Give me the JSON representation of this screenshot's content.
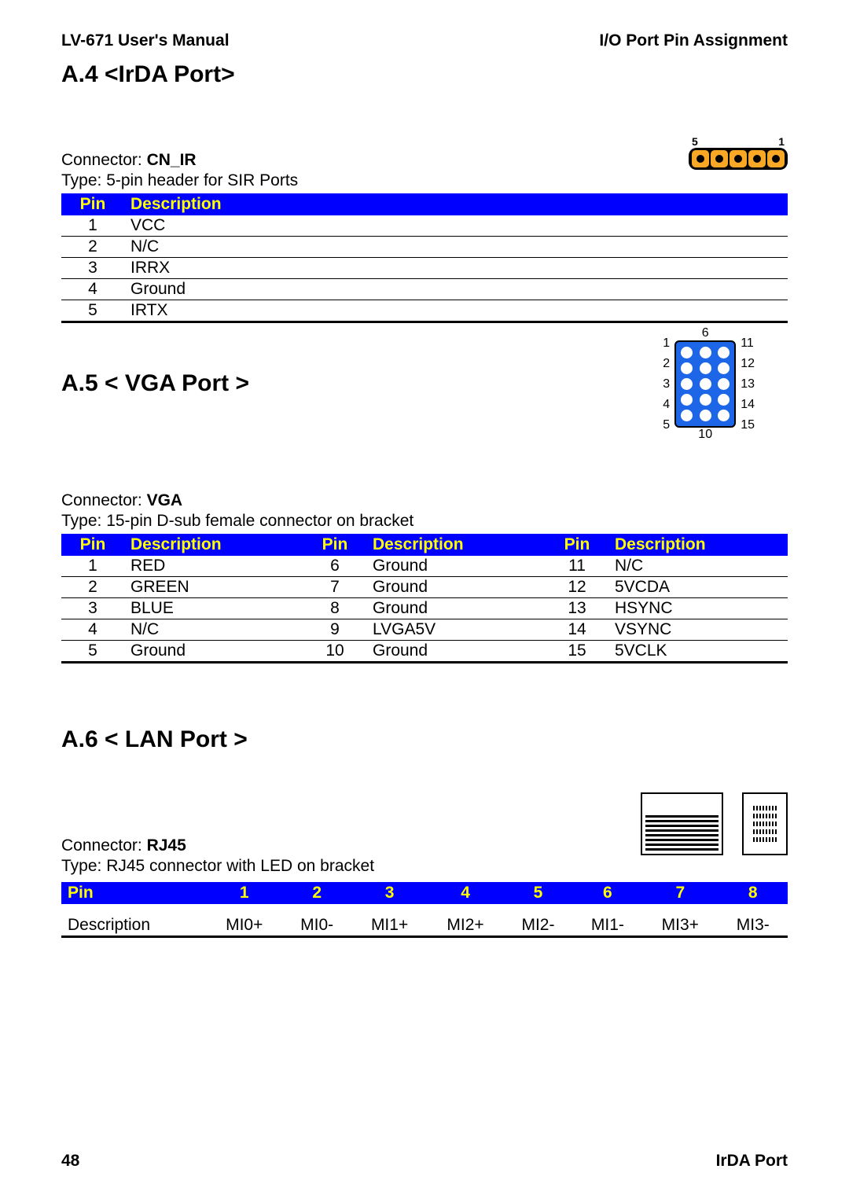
{
  "header": {
    "left": "LV-671 User's Manual",
    "right": "I/O Port Pin Assignment"
  },
  "footer": {
    "page": "48",
    "label": "IrDA Port"
  },
  "irda": {
    "title": "A.4 <IrDA Port>",
    "connector_label": "Connector: ",
    "connector_value": "CN_IR",
    "type": "Type: 5-pin header for SIR Ports",
    "header_labels": {
      "left": "5",
      "right": "1"
    },
    "table_headers": [
      "Pin",
      "Description"
    ],
    "rows": [
      {
        "pin": "1",
        "desc": "VCC"
      },
      {
        "pin": "2",
        "desc": "N/C"
      },
      {
        "pin": "3",
        "desc": "IRRX"
      },
      {
        "pin": "4",
        "desc": "Ground"
      },
      {
        "pin": "5",
        "desc": "IRTX"
      }
    ]
  },
  "vga": {
    "title": "A.5 < VGA Port >",
    "connector_label": "Connector: ",
    "connector_value": "VGA",
    "type": "Type: 15-pin D-sub female connector on bracket",
    "diagram": {
      "left": [
        "1",
        "2",
        "3",
        "4",
        "5"
      ],
      "right": [
        "11",
        "12",
        "13",
        "14",
        "15"
      ],
      "top": "6",
      "bottom": "10"
    },
    "table_headers": [
      "Pin",
      "Description",
      "Pin",
      "Description",
      "Pin",
      "Description"
    ],
    "rows": [
      {
        "p1": "1",
        "d1": "RED",
        "p2": "6",
        "d2": "Ground",
        "p3": "11",
        "d3": "N/C"
      },
      {
        "p1": "2",
        "d1": "GREEN",
        "p2": "7",
        "d2": "Ground",
        "p3": "12",
        "d3": "5VCDA"
      },
      {
        "p1": "3",
        "d1": "BLUE",
        "p2": "8",
        "d2": "Ground",
        "p3": "13",
        "d3": "HSYNC"
      },
      {
        "p1": "4",
        "d1": "N/C",
        "p2": "9",
        "d2": "LVGA5V",
        "p3": "14",
        "d3": "VSYNC"
      },
      {
        "p1": "5",
        "d1": "Ground",
        "p2": "10",
        "d2": "Ground",
        "p3": "15",
        "d3": "5VCLK"
      }
    ]
  },
  "lan": {
    "title": "A.6 < LAN Port >",
    "connector_label": "Connector: ",
    "connector_value": "RJ45",
    "type": "Type: RJ45 connector with LED on bracket",
    "header_row": [
      "Pin",
      "1",
      "2",
      "3",
      "4",
      "5",
      "6",
      "7",
      "8"
    ],
    "data_row": [
      "Description",
      "MI0+",
      "MI0-",
      "MI1+",
      "MI2+",
      "MI2-",
      "MI1-",
      "MI3+",
      "MI3-"
    ]
  }
}
